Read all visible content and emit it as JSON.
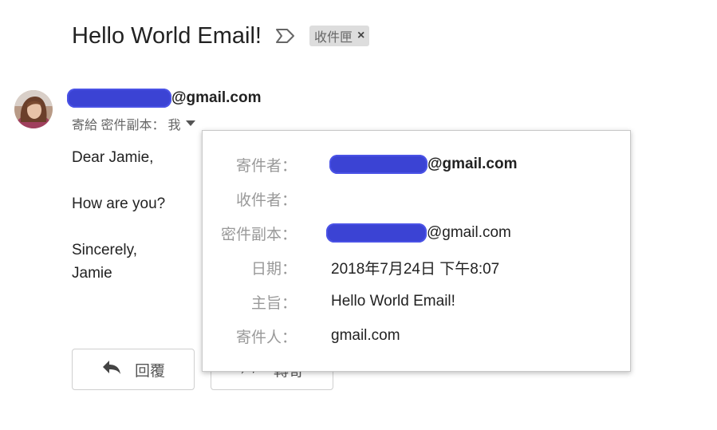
{
  "header": {
    "subject": "Hello World Email!",
    "label_chip": "收件匣",
    "label_remove": "×"
  },
  "sender": {
    "email_suffix": "@gmail.com",
    "recipients_prefix": "寄給 密件副本：",
    "recipients_me": "我"
  },
  "body": {
    "lines": [
      "Dear Jamie,",
      "How are you?",
      "Sincerely,",
      "Jamie"
    ]
  },
  "actions": {
    "reply_label": "回覆",
    "forward_label": "轉寄"
  },
  "details_popup": {
    "from_label": "寄件者：",
    "from_value_suffix": "@gmail.com",
    "to_label": "收件者：",
    "to_value": "",
    "bcc_label": "密件副本：",
    "bcc_value_suffix": "@gmail.com",
    "date_label": "日期：",
    "date_value": "2018年7月24日 下午8:07",
    "subject_label": "主旨：",
    "subject_value": "Hello World Email!",
    "mailed_by_label": "寄件人：",
    "mailed_by_value": "gmail.com"
  },
  "colors": {
    "redaction": "#3b43d4",
    "label_chip_bg": "#dddddd"
  },
  "icons": {
    "important": "important-marker-icon",
    "dropdown": "caret-down-icon",
    "reply": "reply-arrow-icon",
    "forward": "forward-arrow-icon"
  }
}
